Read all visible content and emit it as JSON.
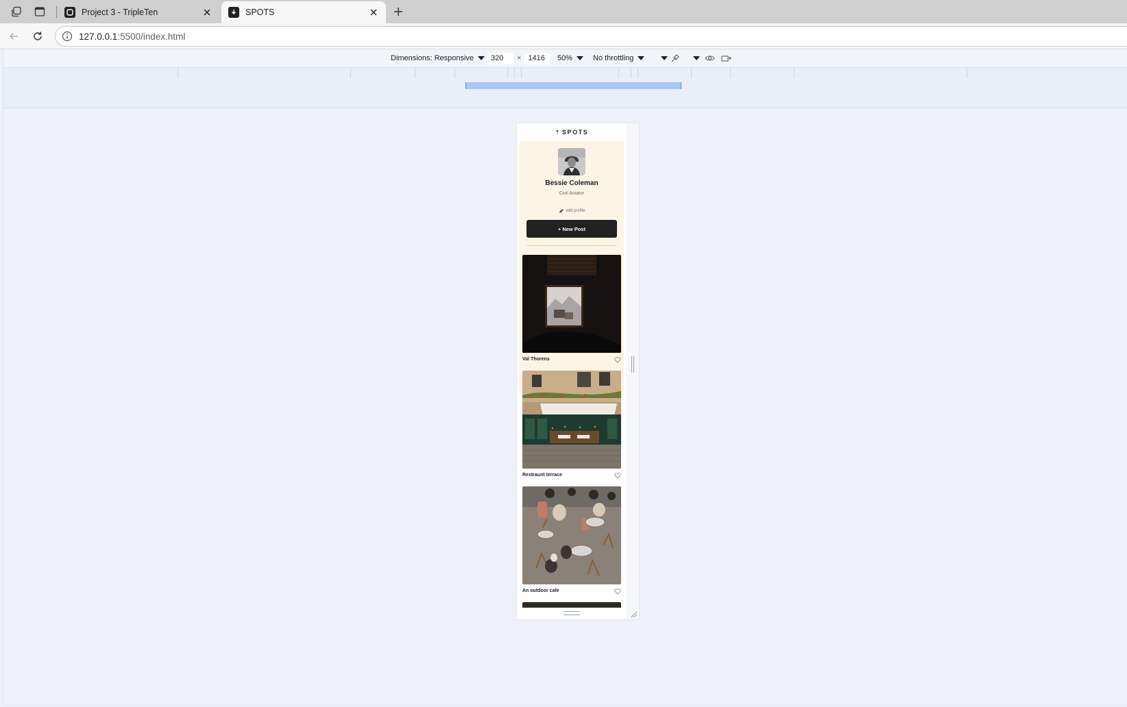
{
  "browser": {
    "tabs": [
      {
        "title": "Project 3 - TripleTen",
        "active": false
      },
      {
        "title": "SPOTS",
        "active": true
      }
    ],
    "url_host": "127.0.0.1",
    "url_rest": ":5500/index.html"
  },
  "device_toolbar": {
    "dimensions_label": "Dimensions: Responsive",
    "width": "320",
    "height": "1416",
    "times": "×",
    "zoom": "50%",
    "throttling": "No throttling"
  },
  "site": {
    "logo_text": "SPOTS",
    "profile": {
      "name": "Bessie Coleman",
      "description": "Civil Aviator",
      "edit_label": "edit profile",
      "new_post_label": "+ New Post"
    },
    "cards": [
      {
        "title": "Val Thorens"
      },
      {
        "title": "Restraunt terrace"
      },
      {
        "title": "An outdoor cafe"
      }
    ]
  },
  "colors": {
    "accent": "#212121",
    "profile_bg": "#fcf5e5",
    "page_bg": "#eef1f8",
    "media_highlight": "#aac8f3"
  }
}
